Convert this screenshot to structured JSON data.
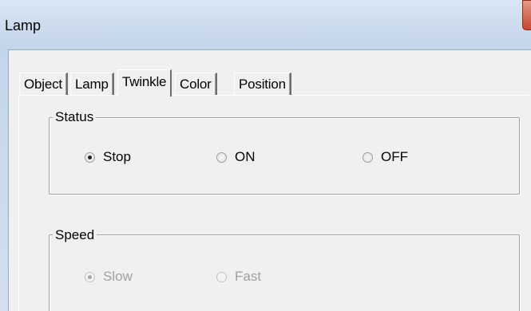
{
  "window": {
    "title": "Lamp"
  },
  "tabs": [
    {
      "label": "Object",
      "active": false
    },
    {
      "label": "Lamp",
      "active": false
    },
    {
      "label": "Twinkle",
      "active": true
    },
    {
      "label": "Color",
      "active": false
    },
    {
      "label": "Position",
      "active": false
    }
  ],
  "status_group": {
    "label": "Status",
    "options": [
      {
        "label": "Stop",
        "checked": true
      },
      {
        "label": "ON",
        "checked": false
      },
      {
        "label": "OFF",
        "checked": false
      }
    ]
  },
  "speed_group": {
    "label": "Speed",
    "enabled": false,
    "options": [
      {
        "label": "Slow",
        "checked": true
      },
      {
        "label": "Fast",
        "checked": false
      }
    ]
  },
  "icons": {
    "close": "close-icon",
    "radio": "radio-button-icon"
  },
  "colors": {
    "titlebar": "#cddcee",
    "close_button": "#c9452e",
    "disabled_text": "#a0a0a0"
  }
}
